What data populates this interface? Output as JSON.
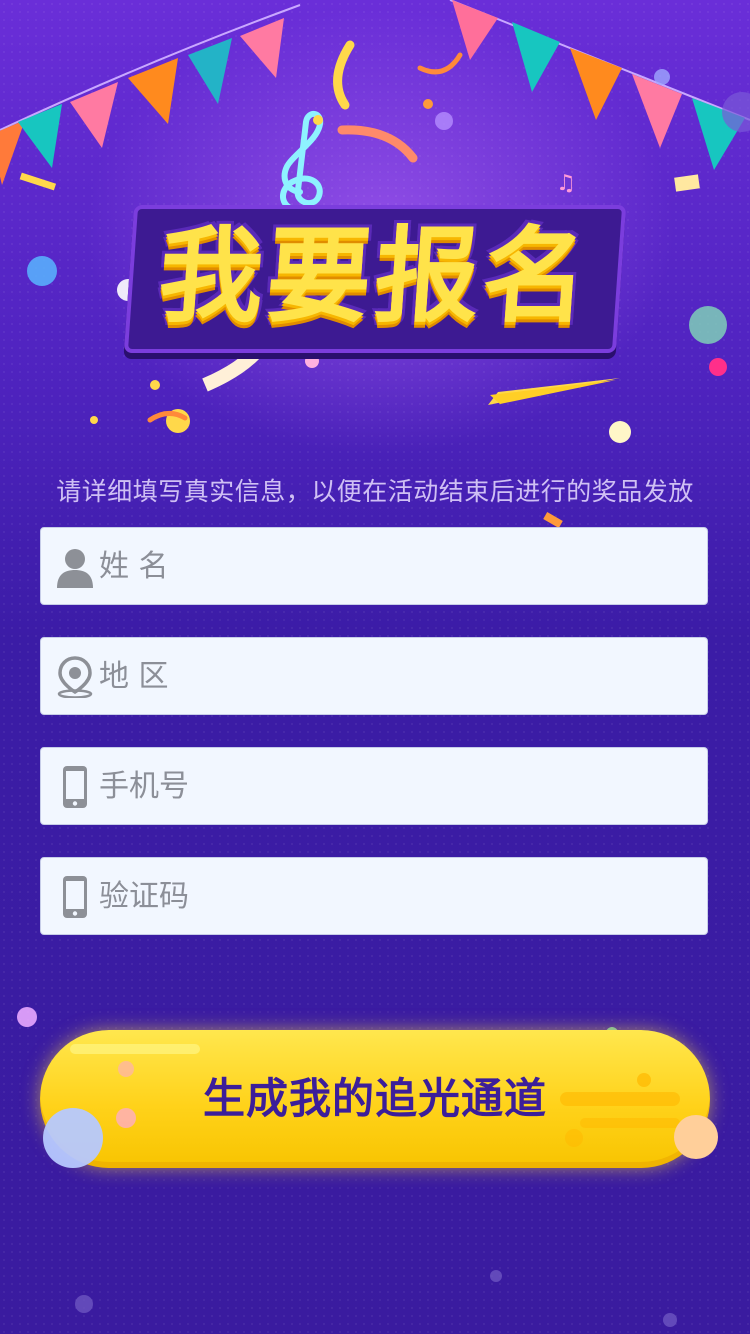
{
  "hero": {
    "title": "我要报名"
  },
  "info": {
    "text": "请详细填写真实信息，以便在活动结束后进行的奖品发放"
  },
  "form": {
    "fields": [
      {
        "id": "name",
        "placeholder": "姓 名",
        "icon": "user-icon"
      },
      {
        "id": "region",
        "placeholder": "地 区",
        "icon": "location-pin-icon"
      },
      {
        "id": "phone",
        "placeholder": "手机号",
        "icon": "phone-icon"
      },
      {
        "id": "code",
        "placeholder": "验证码",
        "icon": "phone-icon"
      }
    ]
  },
  "cta": {
    "label": "生成我的追光通道"
  },
  "colors": {
    "background": "#3a1aa0",
    "title": "#ffe34a",
    "button": "#ffd21a",
    "button_text": "#3c1e9a",
    "field_bg": "#f2f7ff"
  }
}
